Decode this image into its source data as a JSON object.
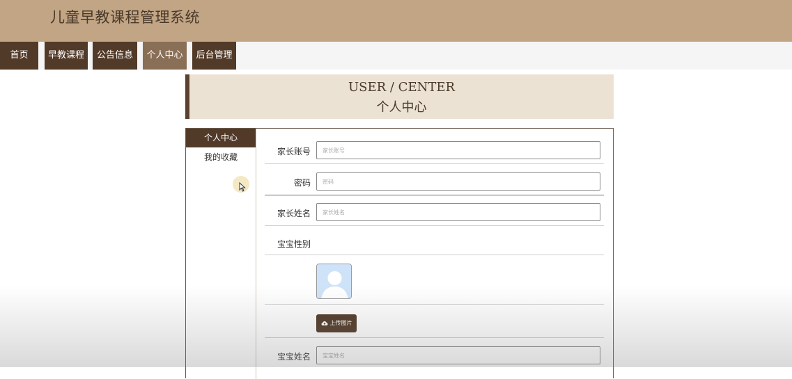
{
  "header": {
    "title": "儿童早教课程管理系统"
  },
  "nav": {
    "items": [
      {
        "label": "首页",
        "active": false
      },
      {
        "label": "早教课程",
        "active": false
      },
      {
        "label": "公告信息",
        "active": false
      },
      {
        "label": "个人中心",
        "active": true
      },
      {
        "label": "后台管理",
        "active": false
      }
    ]
  },
  "banner": {
    "en": "USER / CENTER",
    "cn": "个人中心"
  },
  "sidebar": {
    "items": [
      {
        "label": "个人中心",
        "active": true
      },
      {
        "label": "我的收藏",
        "active": false
      }
    ]
  },
  "form": {
    "account": {
      "label": "家长账号",
      "placeholder": "家长账号"
    },
    "password": {
      "label": "密码",
      "placeholder": "密码"
    },
    "parent_name": {
      "label": "家长姓名",
      "placeholder": "家长姓名"
    },
    "baby_gender": {
      "label": "宝宝性别"
    },
    "upload": {
      "label": "上传图片"
    },
    "baby_name": {
      "label": "宝宝姓名",
      "placeholder": "宝宝姓名"
    }
  },
  "icons": {
    "avatar": "user-avatar-icon",
    "upload": "cloud-upload-icon",
    "cursor": "mouse-pointer-icon"
  },
  "colors": {
    "header": "#c2a585",
    "nav": "#523a28",
    "nav_active": "#8a6f57",
    "banner": "#ebe2d3"
  }
}
